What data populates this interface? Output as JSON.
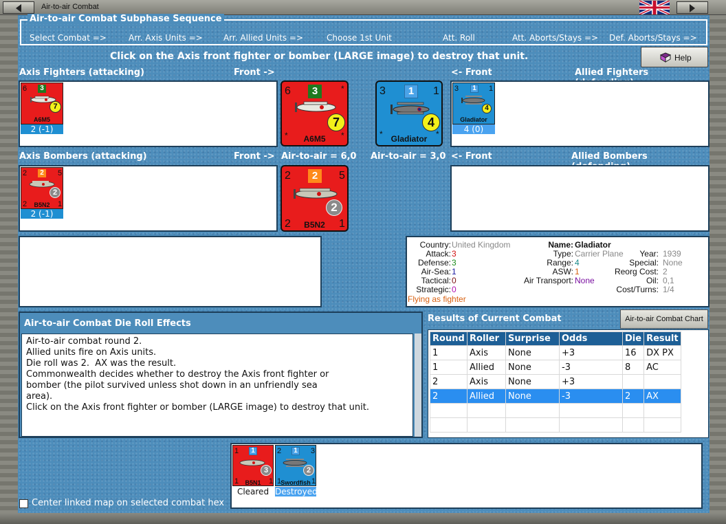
{
  "window": {
    "title": "Air-to-air Combat"
  },
  "subphase": {
    "title": "Air-to-air Combat Subphase Sequence",
    "steps": [
      "Select Combat =>",
      "Arr. Axis Units =>",
      "Arr. Allied Units =>",
      "Choose 1st Unit",
      "Att. Roll",
      "Att. Aborts/Stays =>",
      "Def. Aborts/Stays =>"
    ]
  },
  "instruction": "Click on the Axis front fighter or bomber (LARGE image) to destroy that unit.",
  "help_label": "Help",
  "labels": {
    "axis_fighters": "Axis Fighters (attacking)",
    "front_right": "Front ->",
    "front_left": "<- Front",
    "allied_fighters": "Allied Fighters (defending)",
    "axis_bombers": "Axis Bombers (attacking)",
    "allied_bombers": "Allied Bombers (defending)",
    "axis_air": "Air-to-air = 6,0",
    "allied_air": "Air-to-air = 3,0"
  },
  "units": {
    "axis_fighter_small": {
      "name": "A6M5",
      "left": "6",
      "top": "3",
      "circle": "7",
      "strength": "2 (-1)"
    },
    "axis_fighter_big": {
      "name": "A6M5",
      "left": "6",
      "top": "3",
      "circle": "7",
      "star": "*"
    },
    "allied_fighter_big": {
      "name": "Gladiator",
      "left": "3",
      "top": "1",
      "right": "1",
      "circle": "4",
      "star": "*"
    },
    "allied_fighter_small": {
      "name": "Gladiator",
      "left": "3",
      "top": "1",
      "right": "1",
      "circle": "4",
      "strength": "4 (0)"
    },
    "axis_bomber_small": {
      "name": "B5N2",
      "left": "2",
      "top": "2",
      "right": "5",
      "circle": "2",
      "bl": "2",
      "br": "1",
      "strength": "2 (-1)"
    },
    "axis_bomber_big": {
      "name": "B5N2",
      "left": "2",
      "top": "2",
      "right": "5",
      "circle": "2",
      "bl": "2",
      "br": "1"
    }
  },
  "unit_info": {
    "country_label": "Country:",
    "country": "United Kingdom",
    "attack_label": "Attack:",
    "attack": "3",
    "defense_label": "Defense:",
    "defense": "3",
    "airsea_label": "Air-Sea:",
    "airsea": "1",
    "tactical_label": "Tactical:",
    "tactical": "0",
    "strategic_label": "Strategic:",
    "strategic": "0",
    "flying": "Flying as fighter",
    "name_label": "Name:",
    "name": "Gladiator",
    "type_label": "Type:",
    "type": "Carrier Plane",
    "year_label": "Year:",
    "year": "1939",
    "range_label": "Range:",
    "range": "4",
    "special_label": "Special:",
    "special": "None",
    "asw_label": "ASW:",
    "asw": "1",
    "reorg_label": "Reorg Cost:",
    "reorg": "2",
    "transport_label": "Air Transport:",
    "transport": "None",
    "oil_label": "Oil:",
    "oil": "0,1",
    "cost_label": "Cost/Turns:",
    "cost": "1/4"
  },
  "die_roll": {
    "title": "Air-to-air Combat Die Roll Effects",
    "lines": [
      "Air-to-air combat round 2.",
      "Allied units fire on Axis units.",
      "Die roll was 2.  AX was the result.",
      "Commonwealth decides whether to destroy the Axis front fighter or",
      "bomber (the pilot survived unless shot down in an unfriendly sea",
      "area).",
      "Click on the Axis front fighter or bomber (LARGE image) to destroy that unit."
    ]
  },
  "results": {
    "title": "Results of Current Combat",
    "chart_button": "Air-to-air Combat Chart",
    "headers": [
      "Round",
      "Roller",
      "Surprise",
      "Odds",
      "Die",
      "Result"
    ],
    "rows": [
      [
        "1",
        "Axis",
        "None",
        "+3",
        "16",
        "DX PX"
      ],
      [
        "1",
        "Allied",
        "None",
        "-3",
        "8",
        "AC"
      ],
      [
        "2",
        "Axis",
        "None",
        "+3",
        "",
        ""
      ],
      [
        "2",
        "Allied",
        "None",
        "-3",
        "2",
        "AX"
      ]
    ]
  },
  "losses": [
    {
      "name": "B5N1",
      "left": "1",
      "top": "1",
      "circle": "3",
      "bl": "1",
      "br": "1",
      "status": "Cleared"
    },
    {
      "name": "Swordfish",
      "left": "2",
      "top": "1",
      "right": "3",
      "circle": "2",
      "bl": "1",
      "br": "1",
      "status": "Destroyed"
    }
  ],
  "center_map_label": "Center linked map on selected combat hex",
  "colors": {
    "axis": "#e81c1c",
    "allied": "#1f8fd2",
    "background": "#4d8dbb",
    "selected": "#2a8ef0"
  }
}
